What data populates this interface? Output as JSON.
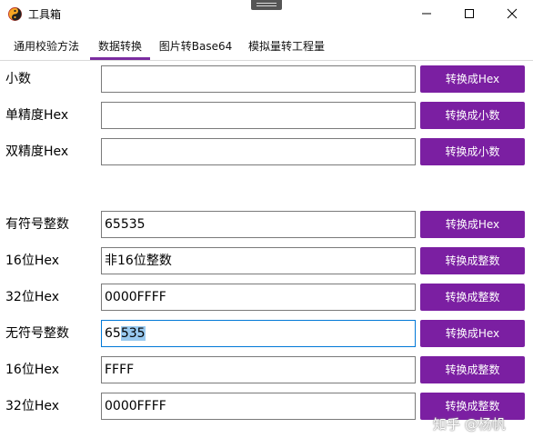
{
  "window": {
    "title": "工具箱"
  },
  "tabs": [
    {
      "label": "通用校验方法"
    },
    {
      "label": "数据转换"
    },
    {
      "label": "图片转Base64"
    },
    {
      "label": "模拟量转工程量"
    }
  ],
  "rows": [
    {
      "label": "小数",
      "value": "",
      "button": "转换成Hex"
    },
    {
      "label": "单精度Hex",
      "value": "",
      "button": "转换成小数"
    },
    {
      "label": "双精度Hex",
      "value": "",
      "button": "转换成小数"
    },
    {
      "label": "有符号整数",
      "value": "65535",
      "button": "转换成Hex"
    },
    {
      "label": "16位Hex",
      "value": "非16位整数",
      "button": "转换成整数"
    },
    {
      "label": "32位Hex",
      "value": "0000FFFF",
      "button": "转换成整数"
    },
    {
      "label": "无符号整数",
      "value_plain": "65",
      "value_selected": "535",
      "button": "转换成Hex"
    },
    {
      "label": "16位Hex",
      "value": "FFFF",
      "button": "转换成整数"
    },
    {
      "label": "32位Hex",
      "value": "0000FFFF",
      "button": "转换成整数"
    }
  ],
  "watermark": "知乎 @杨帆",
  "colors": {
    "accent": "#7b1fa2",
    "focus_border": "#0078d7",
    "selection": "#99c9ef"
  }
}
